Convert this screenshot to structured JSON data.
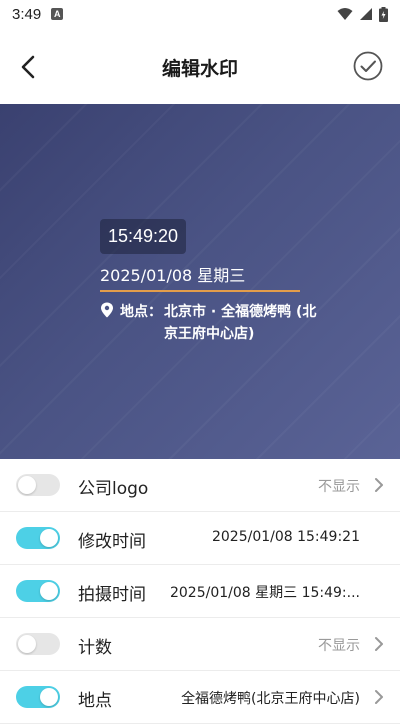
{
  "status_bar": {
    "time": "3:49",
    "notification_icon": "A"
  },
  "header": {
    "title": "编辑水印"
  },
  "preview": {
    "time": "15:49:20",
    "date": "2025/01/08 星期三",
    "location_label": "地点：",
    "location_value": "北京市 · 全福德烤鸭 (北京王府中心店)",
    "accent_color": "#e39d4a"
  },
  "settings": [
    {
      "label": "公司logo",
      "value": "不显示",
      "enabled": false,
      "has_arrow": true
    },
    {
      "label": "修改时间",
      "value": "2025/01/08 15:49:21",
      "enabled": true,
      "has_arrow": false
    },
    {
      "label": "拍摄时间",
      "value": "2025/01/08 星期三 15:49:...",
      "enabled": true,
      "has_arrow": false
    },
    {
      "label": "计数",
      "value": "不显示",
      "enabled": false,
      "has_arrow": true
    },
    {
      "label": "地点",
      "value": "全福德烤鸭(北京王府中心店)",
      "enabled": true,
      "has_arrow": true
    }
  ],
  "colors": {
    "toggle_on": "#4dd0e6",
    "toggle_off": "#e6e6e6",
    "preview_bg": "#4a5384"
  }
}
